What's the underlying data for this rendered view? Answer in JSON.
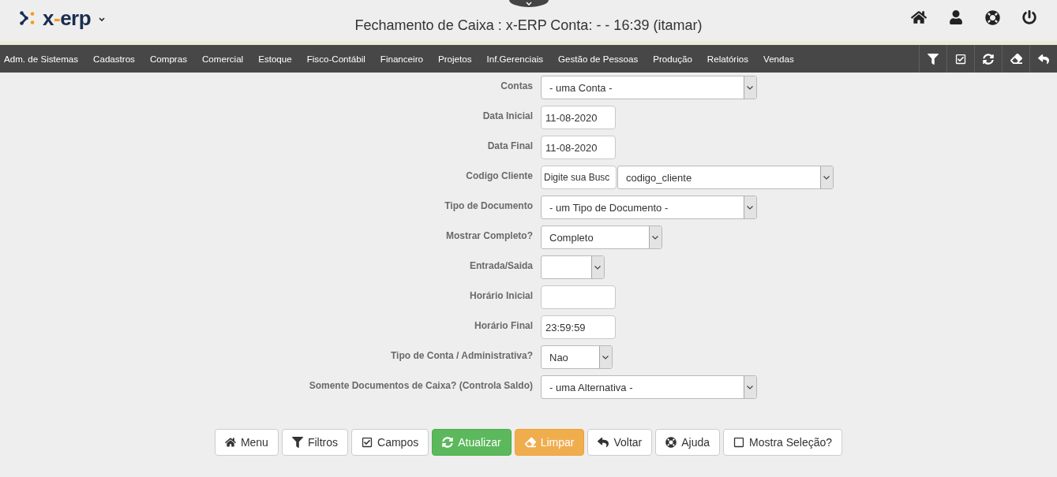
{
  "header": {
    "logo": [
      {
        "text": "x",
        "accent": false
      },
      {
        "text": "-",
        "accent": true
      },
      {
        "text": "erp",
        "accent": false
      }
    ],
    "title": "Fechamento de Caixa : x-ERP Conta: - - 16:39 (itamar)"
  },
  "menu": {
    "items": [
      "Adm. de Sistemas",
      "Cadastros",
      "Compras",
      "Comercial",
      "Estoque",
      "Fisco-Contábil",
      "Financeiro",
      "Projetos",
      "Inf.Gerenciais",
      "Gestão de Pessoas",
      "Produção",
      "Relatórios",
      "Vendas"
    ]
  },
  "form": {
    "fields": [
      {
        "label": "Contas",
        "kind": "select",
        "value": "- uma Conta -"
      },
      {
        "label": "Data Inicial",
        "kind": "input",
        "value": "11-08-2020"
      },
      {
        "label": "Data Final",
        "kind": "input",
        "value": "11-08-2020"
      },
      {
        "label": "Codigo Cliente",
        "kind": "search-select",
        "input_value": "Digite sua Busc",
        "value": "codigo_cliente"
      },
      {
        "label": "Tipo de Documento",
        "kind": "select",
        "value": "- um Tipo de Documento -"
      },
      {
        "label": "Mostrar Completo?",
        "kind": "select",
        "value": "Completo"
      },
      {
        "label": "Entrada/Saida",
        "kind": "select"
      },
      {
        "label": "Horário Inicial",
        "kind": "input"
      },
      {
        "label": "Horário Final",
        "kind": "input",
        "value": "23:59:59"
      },
      {
        "label": "Tipo de Conta / Administrativa?",
        "kind": "select",
        "value": "Nao"
      },
      {
        "label": "Somente Documentos de Caixa? (Controla Saldo)",
        "kind": "select",
        "value": "- uma Alternativa -"
      }
    ]
  },
  "buttons": [
    {
      "label": "Menu",
      "kind": "plain"
    },
    {
      "label": "Filtros",
      "kind": "plain"
    },
    {
      "label": "Campos",
      "kind": "plain"
    },
    {
      "label": "Atualizar",
      "kind": "success"
    },
    {
      "label": "Limpar",
      "kind": "warning"
    },
    {
      "label": "Voltar",
      "kind": "plain"
    },
    {
      "label": "Ajuda",
      "kind": "plain"
    },
    {
      "label": "Mostra Seleção?",
      "kind": "toggle",
      "checked": false
    }
  ]
}
